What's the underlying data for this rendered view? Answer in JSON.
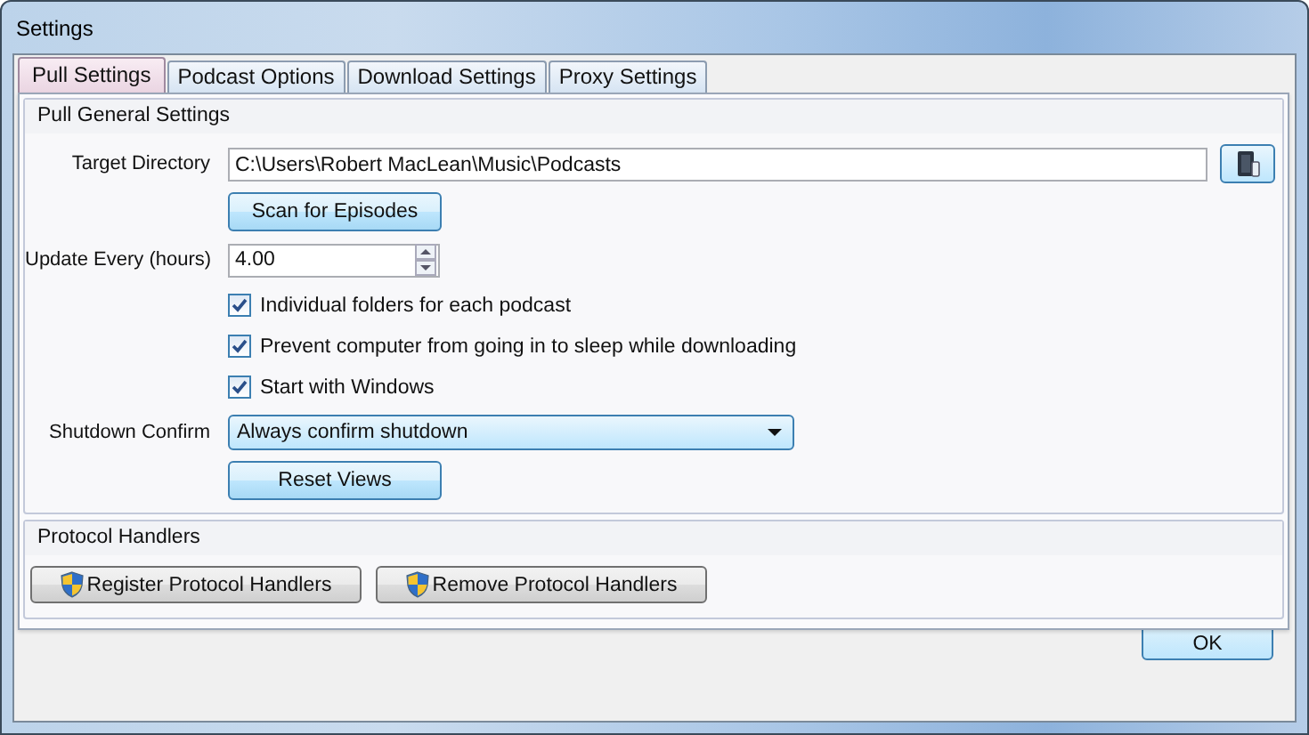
{
  "window": {
    "title": "Settings"
  },
  "tabs": [
    {
      "label": "Pull Settings",
      "selected": true
    },
    {
      "label": "Podcast Options",
      "selected": false
    },
    {
      "label": "Download Settings",
      "selected": false
    },
    {
      "label": "Proxy Settings",
      "selected": false
    }
  ],
  "pull_general": {
    "title": "Pull General Settings",
    "target_directory": {
      "label": "Target Directory",
      "value": "C:\\Users\\Robert MacLean\\Music\\Podcasts"
    },
    "scan_button": "Scan for Episodes",
    "update_every": {
      "label": "Update Every (hours)",
      "value": "4.00"
    },
    "checkboxes": [
      {
        "label": "Individual folders for each podcast",
        "checked": true
      },
      {
        "label": "Prevent computer from going in to sleep while downloading",
        "checked": true
      },
      {
        "label": "Start with Windows",
        "checked": true
      }
    ],
    "shutdown_confirm": {
      "label": "Shutdown Confirm",
      "value": "Always confirm shutdown"
    },
    "reset_button": "Reset Views"
  },
  "protocol_handlers": {
    "title": "Protocol Handlers",
    "buttons": [
      "Register Protocol Handlers",
      "Remove Protocol Handlers"
    ]
  },
  "ok_button": "OK"
}
